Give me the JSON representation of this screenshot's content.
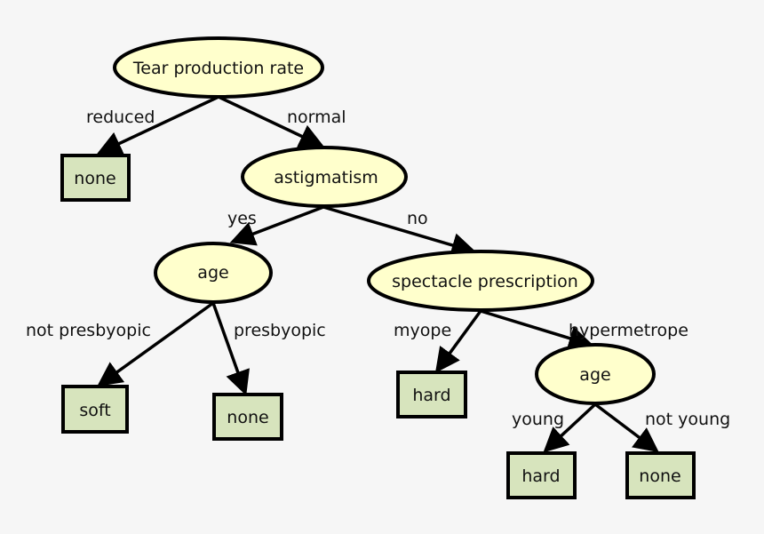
{
  "colors": {
    "decision_fill": "#ffffcc",
    "leaf_fill": "#d7e4bd",
    "stroke": "#000000",
    "background": "#f6f6f6"
  },
  "nodes": {
    "root": "Tear production rate",
    "leaf_reduced": "none",
    "astigmatism": "astigmatism",
    "age1": "age",
    "spectacle": "spectacle prescription",
    "leaf_not_presbyopic": "soft",
    "leaf_presbyopic": "none",
    "leaf_myope": "hard",
    "age2": "age",
    "leaf_young": "hard",
    "leaf_not_young": "none"
  },
  "edges": {
    "reduced": "reduced",
    "normal": "normal",
    "yes": "yes",
    "no": "no",
    "not_presbyopic": "not presbyopic",
    "presbyopic": "presbyopic",
    "myope": "myope",
    "hypermetrope": "hypermetrope",
    "young": "young",
    "not_young": "not young"
  }
}
